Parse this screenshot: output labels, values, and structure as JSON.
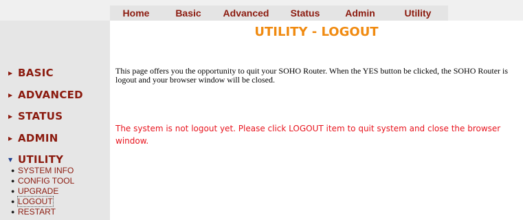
{
  "top_nav": {
    "items": [
      {
        "label": "Home"
      },
      {
        "label": "Basic"
      },
      {
        "label": "Advanced"
      },
      {
        "label": "Status"
      },
      {
        "label": "Admin"
      },
      {
        "label": "Utility"
      }
    ]
  },
  "sidebar": {
    "items": [
      {
        "label": "BASIC",
        "icon": "triangle-right-icon"
      },
      {
        "label": "ADVANCED",
        "icon": "triangle-right-icon"
      },
      {
        "label": "STATUS",
        "icon": "triangle-right-icon"
      },
      {
        "label": "ADMIN",
        "icon": "triangle-right-icon"
      },
      {
        "label": "UTILITY",
        "icon": "triangle-down-icon",
        "expanded": true
      }
    ],
    "utility_submenu": [
      {
        "label": "SYSTEM INFO"
      },
      {
        "label": "CONFIG TOOL"
      },
      {
        "label": "UPGRADE"
      },
      {
        "label": "LOGOUT",
        "active": true
      },
      {
        "label": "RESTART"
      }
    ]
  },
  "main": {
    "title": "UTILITY - LOGOUT",
    "description": "This page offers you the opportunity to quit your SOHO Router. When the YES button be clicked, the SOHO Router is logout and your browser window will be closed.",
    "status_message": "The system is not logout yet. Please click LOGOUT item to quit system and close the browser window."
  },
  "colors": {
    "nav_text": "#8b1a0e",
    "title": "#f08a10",
    "status_message": "#e8141e",
    "sidebar_bg": "#e6e6e6"
  }
}
